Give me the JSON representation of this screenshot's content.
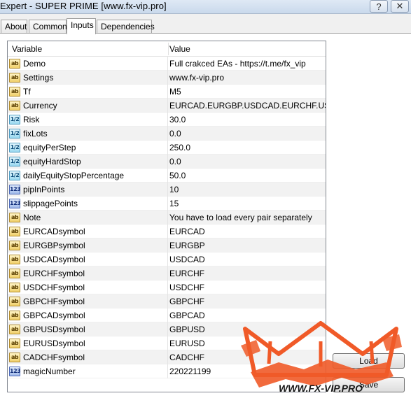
{
  "window": {
    "title": "Expert - SUPER PRIME [www.fx-vip.pro]"
  },
  "tabs": [
    {
      "label": "About"
    },
    {
      "label": "Common"
    },
    {
      "label": "Inputs"
    },
    {
      "label": "Dependencies"
    }
  ],
  "grid": {
    "header_variable": "Variable",
    "header_value": "Value",
    "rows": [
      {
        "type": "ab",
        "name": "Demo",
        "value": "Full crakced EAs - https://t.me/fx_vip"
      },
      {
        "type": "ab",
        "name": "Settings",
        "value": "www.fx-vip.pro"
      },
      {
        "type": "ab",
        "name": "Tf",
        "value": "M5"
      },
      {
        "type": "ab",
        "name": "Currency",
        "value": "EURCAD.EURGBP.USDCAD.EURCHF.US..."
      },
      {
        "type": "dbl",
        "name": "Risk",
        "value": "30.0"
      },
      {
        "type": "dbl",
        "name": "fixLots",
        "value": "0.0"
      },
      {
        "type": "dbl",
        "name": "equityPerStep",
        "value": "250.0"
      },
      {
        "type": "dbl",
        "name": "equityHardStop",
        "value": "0.0"
      },
      {
        "type": "dbl",
        "name": "dailyEquityStopPercentage",
        "value": "50.0"
      },
      {
        "type": "int",
        "name": "pipInPoints",
        "value": "10"
      },
      {
        "type": "int",
        "name": "slippagePoints",
        "value": "15"
      },
      {
        "type": "ab",
        "name": "Note",
        "value": "You have to load every pair separately"
      },
      {
        "type": "ab",
        "name": "EURCADsymbol",
        "value": "EURCAD"
      },
      {
        "type": "ab",
        "name": "EURGBPsymbol",
        "value": "EURGBP"
      },
      {
        "type": "ab",
        "name": "USDCADsymbol",
        "value": "USDCAD"
      },
      {
        "type": "ab",
        "name": "EURCHFsymbol",
        "value": "EURCHF"
      },
      {
        "type": "ab",
        "name": "USDCHFsymbol",
        "value": "USDCHF"
      },
      {
        "type": "ab",
        "name": "GBPCHFsymbol",
        "value": "GBPCHF"
      },
      {
        "type": "ab",
        "name": "GBPCADsymbol",
        "value": "GBPCAD"
      },
      {
        "type": "ab",
        "name": "GBPUSDsymbol",
        "value": "GBPUSD"
      },
      {
        "type": "ab",
        "name": "EURUSDsymbol",
        "value": "EURUSD"
      },
      {
        "type": "ab",
        "name": "CADCHFsymbol",
        "value": "CADCHF"
      },
      {
        "type": "int",
        "name": "magicNumber",
        "value": "220221199"
      }
    ]
  },
  "icons": {
    "ab": "ab",
    "dbl": "1/2",
    "int": "123"
  },
  "buttons": {
    "load": "Load",
    "save": "Save"
  },
  "watermark": {
    "text": "WWW.FX-VIP.PRO",
    "color": "#f05a28"
  },
  "colors": {
    "grid_alt_row": "#f2f2f2",
    "titlebar": "#c9d9ec"
  }
}
